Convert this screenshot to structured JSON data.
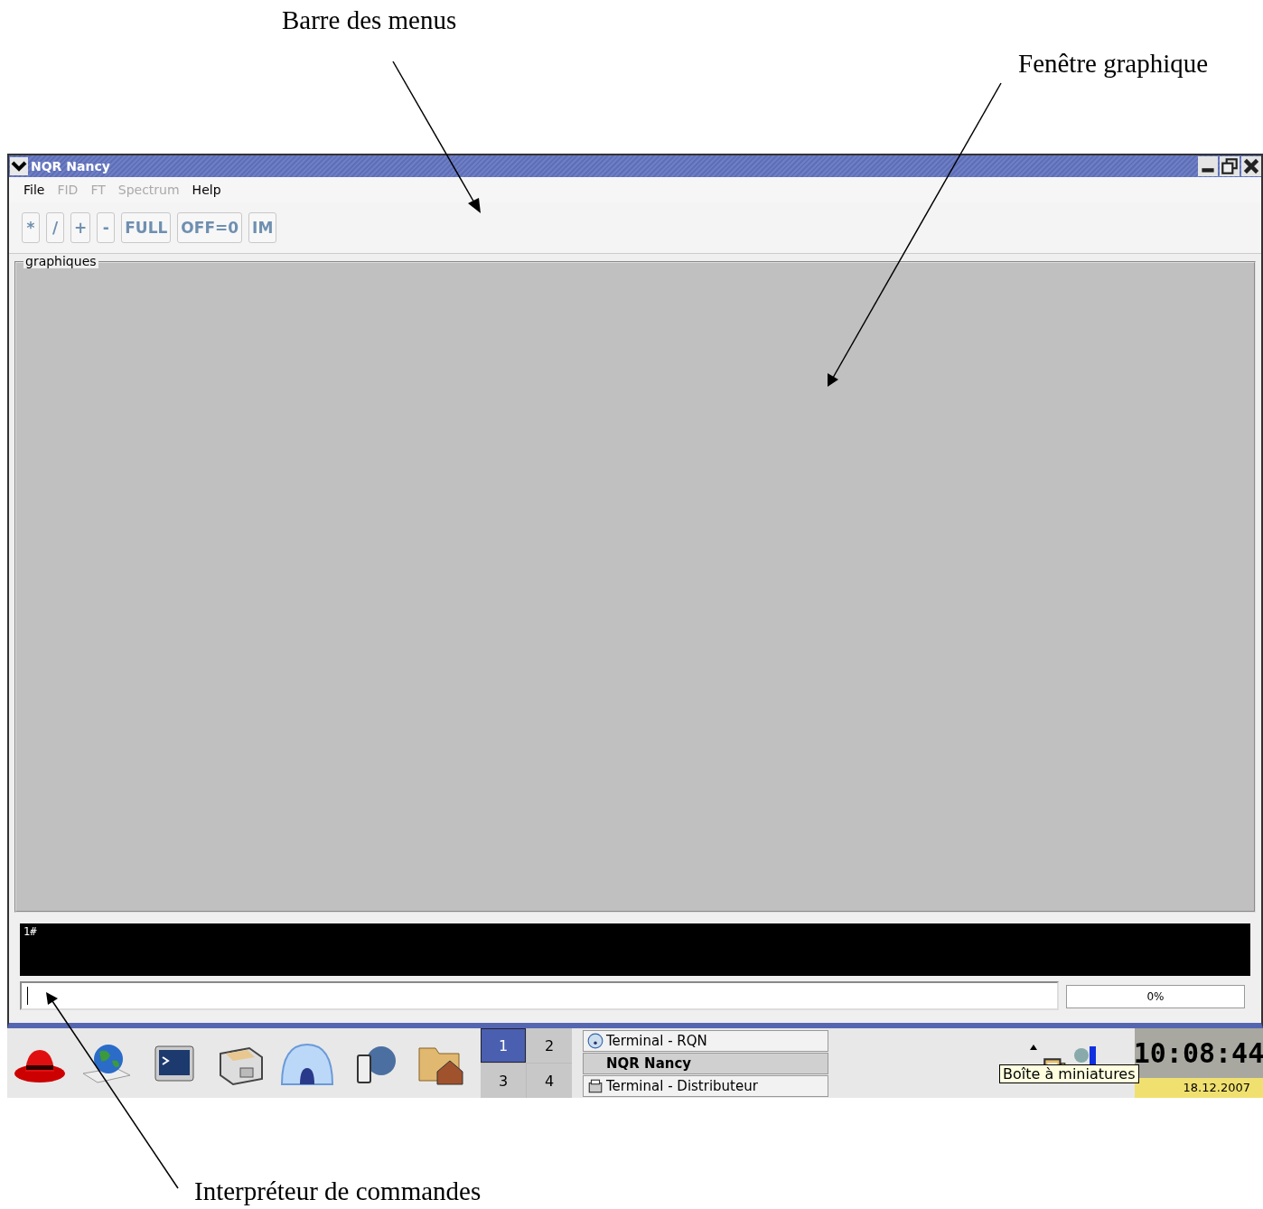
{
  "annotations": [
    {
      "text": "Barre des menus"
    },
    {
      "text": "Fenêtre graphique"
    },
    {
      "text": "Interpréteur de commandes"
    }
  ],
  "window": {
    "title": "NQR Nancy"
  },
  "menu": [
    {
      "label": "File",
      "disabled": false
    },
    {
      "label": "FID",
      "disabled": true
    },
    {
      "label": "FT",
      "disabled": true
    },
    {
      "label": "Spectrum",
      "disabled": true
    },
    {
      "label": "Help",
      "disabled": false
    }
  ],
  "toolbar": [
    {
      "label": "*",
      "disabled": true
    },
    {
      "label": "/",
      "disabled": true
    },
    {
      "label": "+",
      "disabled": true
    },
    {
      "label": "-",
      "disabled": true
    },
    {
      "label": "FULL",
      "disabled": true
    },
    {
      "label": "OFF=0",
      "disabled": true
    },
    {
      "label": "IM",
      "disabled": true
    }
  ],
  "graphics": {
    "label": "graphiques"
  },
  "console": {
    "output": "1#"
  },
  "progress": {
    "reading": "0%",
    "level": 0
  },
  "taskbar": {
    "desktops": [
      {
        "label": "1",
        "selected": true
      },
      {
        "label": "2",
        "selected": false
      },
      {
        "label": "3",
        "selected": false
      },
      {
        "label": "4",
        "selected": false
      }
    ],
    "tasks": [
      {
        "label": "Terminal - RQN",
        "selected": false
      },
      {
        "label": "NQR Nancy",
        "selected": true
      },
      {
        "label": "Terminal - Distributeur",
        "selected": false
      }
    ],
    "tooltip": "Boîte à miniatures",
    "clock": {
      "time": "10:08:44",
      "date": "18.12.2007"
    }
  }
}
